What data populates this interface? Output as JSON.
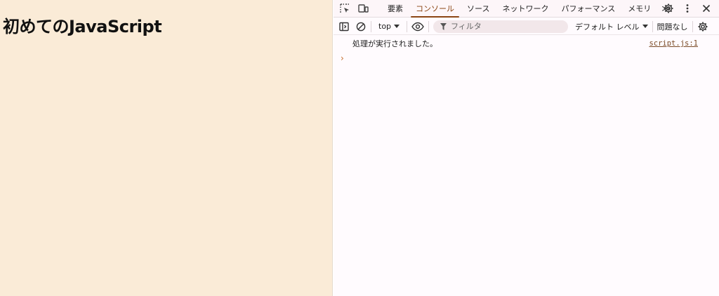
{
  "page": {
    "heading": "初めてのJavaScript"
  },
  "devtools": {
    "tabs": [
      "要素",
      "コンソール",
      "ソース",
      "ネットワーク",
      "パフォーマンス",
      "メモリ"
    ],
    "active_tab": "コンソール",
    "more_tabs": "≫",
    "toolbar": {
      "context": "top",
      "filter_placeholder": "フィルタ",
      "levels": "デフォルト レベル",
      "issues": "問題なし"
    },
    "console": {
      "messages": [
        {
          "text": "処理が実行されました。",
          "source": "script.js:1"
        }
      ],
      "prompt": "›"
    }
  }
}
